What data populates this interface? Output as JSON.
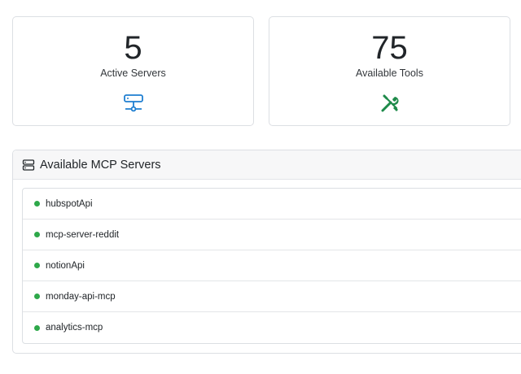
{
  "stats": {
    "servers": {
      "value": "5",
      "label": "Active Servers",
      "icon": "server-network-icon",
      "icon_color": "#1f7fd1"
    },
    "tools": {
      "value": "75",
      "label": "Available Tools",
      "icon": "tools-icon",
      "icon_color": "#1e8a4a"
    }
  },
  "panel": {
    "title": "Available MCP Servers",
    "icon": "server-stack-icon"
  },
  "servers": [
    {
      "name": "hubspotApi",
      "status_color": "#2ea84a"
    },
    {
      "name": "mcp-server-reddit",
      "status_color": "#2ea84a"
    },
    {
      "name": "notionApi",
      "status_color": "#2ea84a"
    },
    {
      "name": "monday-api-mcp",
      "status_color": "#2ea84a"
    },
    {
      "name": "analytics-mcp",
      "status_color": "#2ea84a"
    }
  ]
}
